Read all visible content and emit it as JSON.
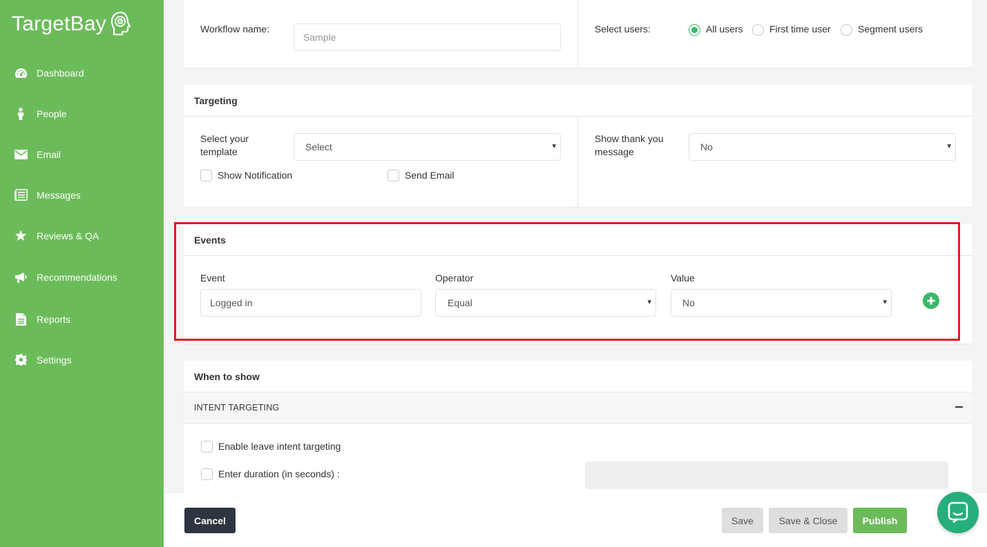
{
  "brand": {
    "name": "TargetBay",
    "icon": "head-target-icon"
  },
  "sidebar": {
    "items": [
      {
        "label": "Dashboard",
        "icon": "dashboard-gauge-icon"
      },
      {
        "label": "People",
        "icon": "person-icon"
      },
      {
        "label": "Email",
        "icon": "envelope-icon"
      },
      {
        "label": "Messages",
        "icon": "messages-list-icon"
      },
      {
        "label": "Reviews & QA",
        "icon": "star-icon"
      },
      {
        "label": "Recommendations",
        "icon": "megaphone-icon"
      },
      {
        "label": "Reports",
        "icon": "document-icon"
      },
      {
        "label": "Settings",
        "icon": "gear-icon"
      }
    ]
  },
  "workflow": {
    "name_label": "Workflow name:",
    "name_placeholder": "Sample",
    "users_label": "Select users:",
    "user_options": [
      "All users",
      "First time user",
      "Segment users"
    ],
    "selected_user_option": "All users"
  },
  "targeting": {
    "title": "Targeting",
    "template_label": "Select your template",
    "template_value": "Select",
    "show_notification_label": "Show Notification",
    "send_email_label": "Send Email",
    "thank_you_label": "Show thank you message",
    "thank_you_value": "No"
  },
  "events": {
    "title": "Events",
    "event_label": "Event",
    "event_value": "Logged in",
    "operator_label": "Operator",
    "operator_value": "Equal",
    "value_label": "Value",
    "value_value": "No",
    "add_icon": "plus-circle-icon"
  },
  "when_to_show": {
    "title": "When to show",
    "section": "INTENT TARGETING",
    "leave_intent_label": "Enable leave intent targeting",
    "duration_label": "Enter duration (in seconds) :",
    "duration_value": ""
  },
  "footer": {
    "cancel": "Cancel",
    "save": "Save",
    "save_close": "Save & Close",
    "publish": "Publish"
  },
  "colors": {
    "sidebar": "#6cbb5a",
    "accent": "#3bb76a",
    "highlight": "#e11b22",
    "cancel": "#2e3440"
  }
}
